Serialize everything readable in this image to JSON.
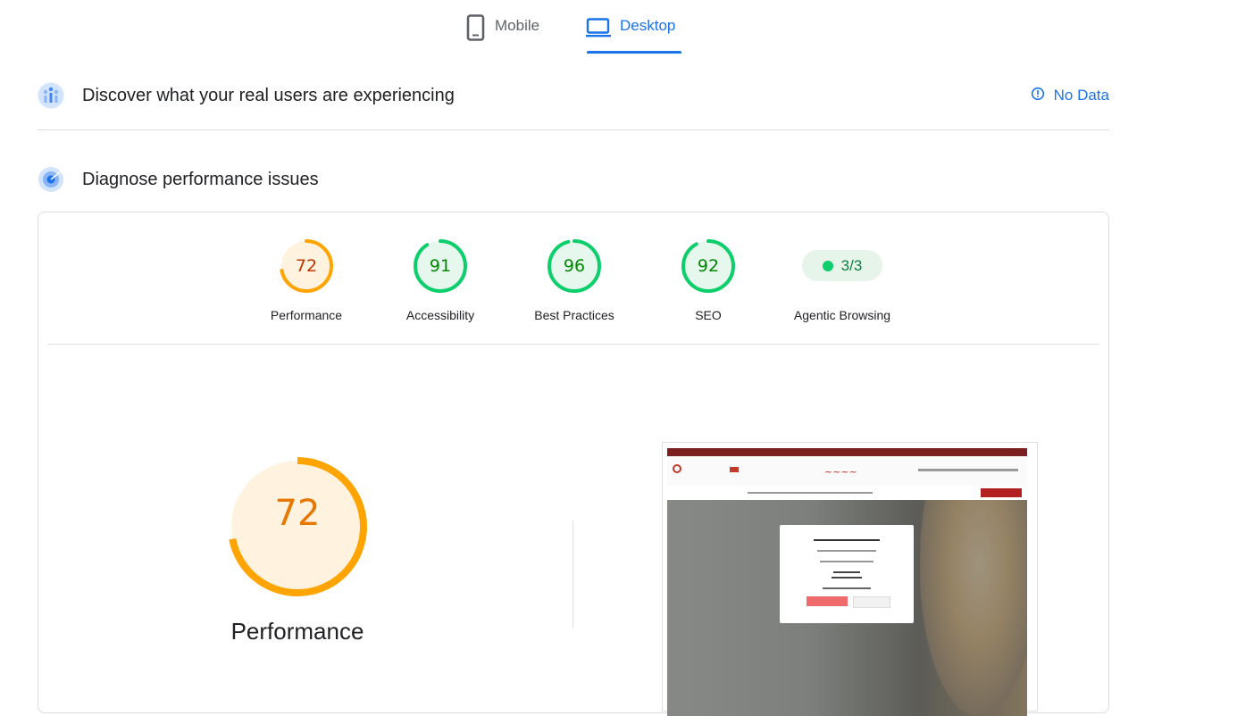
{
  "tabs": [
    {
      "label": "Mobile",
      "icon": "smartphone-icon",
      "active": false
    },
    {
      "label": "Desktop",
      "icon": "laptop-icon",
      "active": true
    }
  ],
  "crux": {
    "title": "Discover what your real users are experiencing",
    "status": "No Data",
    "status_icon": "info-icon"
  },
  "diagnose": {
    "title": "Diagnose performance issues"
  },
  "categories": [
    {
      "label": "Performance",
      "score": "72",
      "color": "#ffa400",
      "text_color": "#c33300",
      "fraction": 0.72
    },
    {
      "label": "Accessibility",
      "score": "91",
      "color": "#0cce6b",
      "text_color": "#008800",
      "fraction": 0.91
    },
    {
      "label": "Best Practices",
      "score": "96",
      "color": "#0cce6b",
      "text_color": "#008800",
      "fraction": 0.96
    },
    {
      "label": "SEO",
      "score": "92",
      "color": "#0cce6b",
      "text_color": "#008800",
      "fraction": 0.92
    },
    {
      "label": "Agentic Browsing",
      "score": "3/3",
      "color": "#0cce6b"
    }
  ],
  "main_gauge": {
    "label": "Performance",
    "score": "72",
    "fraction": 0.72,
    "color": "#ffa400"
  },
  "colors": {
    "accent": "#1a73e8",
    "pass": "#0cce6b",
    "average": "#ffa400"
  }
}
